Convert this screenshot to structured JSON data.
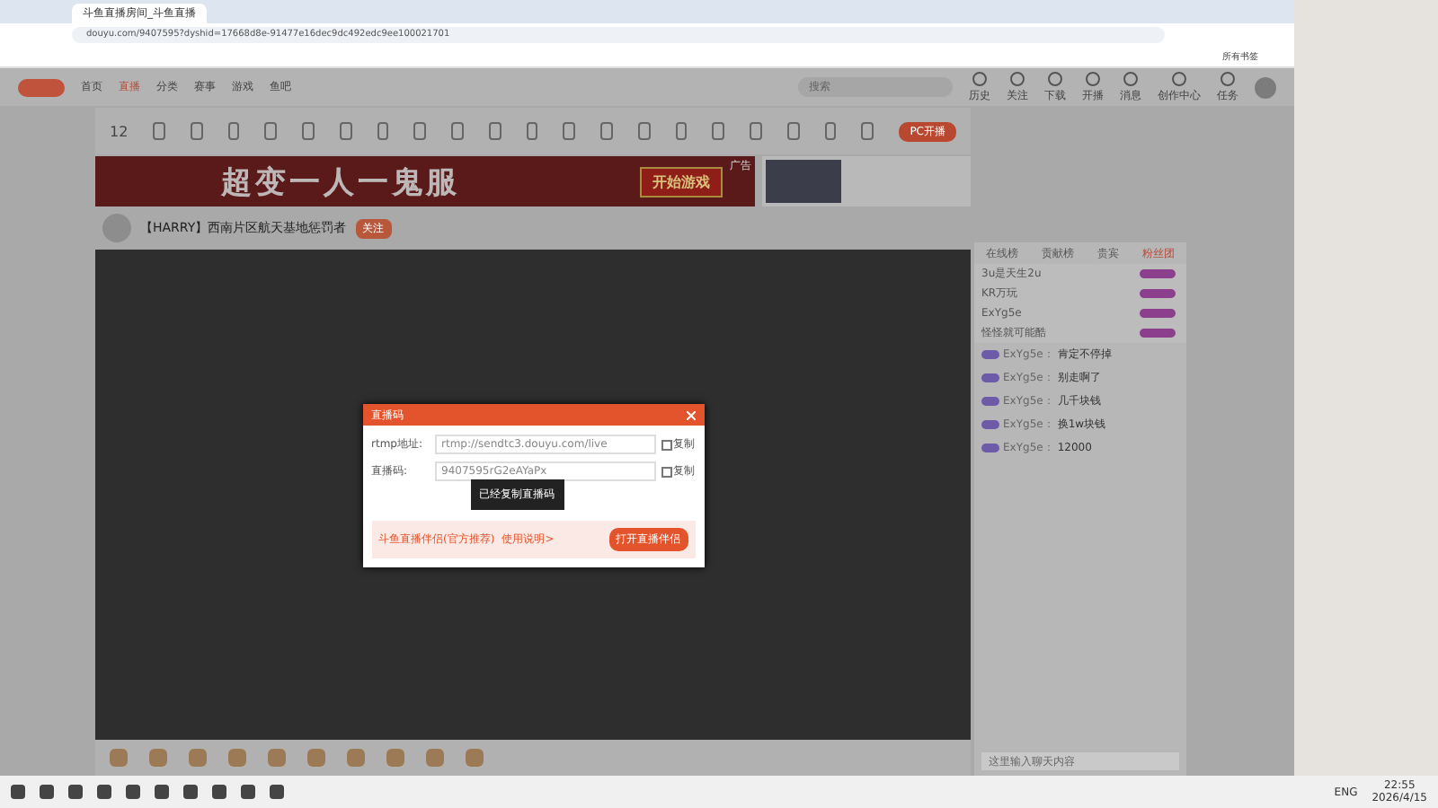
{
  "browser": {
    "tab_title": "斗鱼直播房间_斗鱼直播",
    "url": "douyu.com/9407595?dyshid=17668d8e-91477e16dec9dc492edc9ee100021701",
    "bookmarks_label": "所有书签"
  },
  "header": {
    "nav": [
      {
        "label": "首页",
        "selected": false
      },
      {
        "label": "直播",
        "selected": true
      },
      {
        "label": "分类",
        "selected": false
      },
      {
        "label": "赛事",
        "selected": false
      },
      {
        "label": "游戏",
        "selected": false
      },
      {
        "label": "鱼吧",
        "selected": false
      }
    ],
    "search": {
      "placeholder": "搜索"
    },
    "actions": [
      "历史",
      "关注",
      "下载",
      "开播",
      "消息",
      "创作中心",
      "任务"
    ]
  },
  "toolbar": {
    "score": "12",
    "button": "PC开播"
  },
  "banner": {
    "title": "超变一人一鬼服",
    "cta": "开始游戏",
    "ad_label": "广告"
  },
  "room": {
    "title": "【HARRY】西南片区航天基地惩罚者",
    "follow": "关注"
  },
  "modal": {
    "title": "直播码",
    "fields": [
      {
        "label": "rtmp地址:",
        "value": "rtmp://sendtc3.douyu.com/live",
        "copy": "复制",
        "checked": false
      },
      {
        "label": "直播码:",
        "value": "9407595rG2eAYaPx",
        "copy": "复制",
        "checked": false
      }
    ],
    "toast": "已经复制直播码",
    "promo": {
      "title": "斗鱼直播伴侣(官方推荐)",
      "link": "使用说明>",
      "button": "打开直播伴侣"
    }
  },
  "chat": {
    "tabs": [
      {
        "label": "在线榜",
        "selected": false
      },
      {
        "label": "贡献榜",
        "selected": false
      },
      {
        "label": "贵宾",
        "selected": false
      },
      {
        "label": "粉丝团",
        "selected": true
      }
    ],
    "ranks": [
      "3u是天生2u",
      "KR万玩",
      "ExYg5e",
      "怪怪就可能酷"
    ],
    "messages": [
      {
        "user": "ExYg5e：",
        "text": "肯定不停掉"
      },
      {
        "user": "ExYg5e：",
        "text": "别走啊了"
      },
      {
        "user": "ExYg5e：",
        "text": "几千块钱"
      },
      {
        "user": "ExYg5e：",
        "text": "换1w块钱"
      },
      {
        "user": "ExYg5e：",
        "text": "12000"
      }
    ],
    "placeholder": "这里输入聊天内容"
  },
  "taskbar": {
    "lang": "ENG",
    "time": "22:55",
    "date": "2026/4/15"
  }
}
